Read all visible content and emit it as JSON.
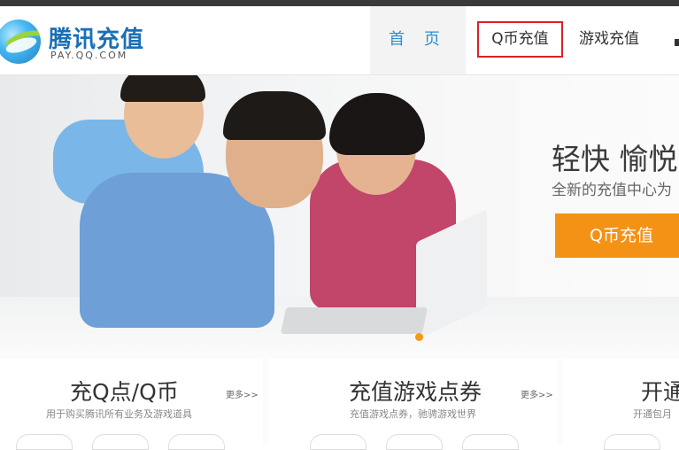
{
  "header": {
    "brand_name": "腾讯充值",
    "brand_url": "PAY.QQ.COM",
    "nav": {
      "home": "首 页",
      "q_recharge": "Q币充值",
      "game_recharge": "游戏充值"
    }
  },
  "hero": {
    "slogan": "轻快 愉悦的",
    "subslogan": "全新的充值中心为",
    "cta_label": "Q币充值"
  },
  "cards": [
    {
      "title": "充Q点/Q币",
      "more": "更多>>",
      "desc": "用于购买腾讯所有业务及游戏道具"
    },
    {
      "title": "充值游戏点券",
      "more": "更多>>",
      "desc": "充值游戏点券，驰骋游戏世界"
    },
    {
      "title": "开通",
      "desc": "开通包月"
    }
  ],
  "colors": {
    "brand_blue": "#1a6fb5",
    "nav_active": "#2f8fd0",
    "highlight_border": "#d8222b",
    "cta_orange": "#f49216"
  }
}
